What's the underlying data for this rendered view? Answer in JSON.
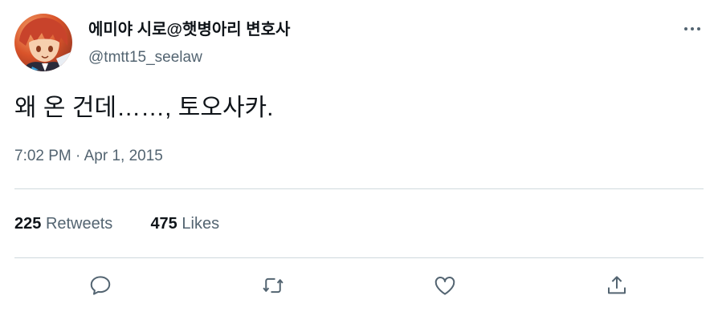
{
  "author": {
    "display_name": "에미야 시로@햇병아리 변호사",
    "handle": "@tmtt15_seelaw"
  },
  "tweet": {
    "text": "왜 온 건데……, 토오사카.",
    "timestamp": "7:02 PM · Apr 1, 2015"
  },
  "stats": {
    "retweets_count": "225",
    "retweets_label": "Retweets",
    "likes_count": "475",
    "likes_label": "Likes"
  },
  "actions": {
    "reply_icon": "speech-bubble",
    "retweet_icon": "retweet-arrows",
    "like_icon": "heart",
    "share_icon": "upload-arrow"
  },
  "colors": {
    "text_primary": "#0f1419",
    "text_secondary": "#536471",
    "divider": "#cfd9de"
  }
}
